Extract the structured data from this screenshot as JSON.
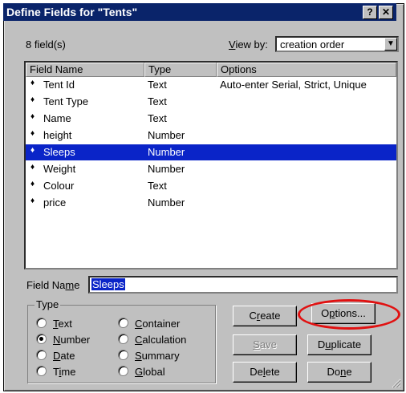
{
  "window": {
    "title": "Define Fields for \"Tents\"",
    "help_label": "?",
    "close_label": "✕"
  },
  "field_count": "8 field(s)",
  "view_by": {
    "label_prefix": "",
    "label_underlined": "V",
    "label_rest": "iew by:",
    "value": "creation order"
  },
  "table": {
    "headers": [
      "Field Name",
      "Type",
      "Options"
    ],
    "rows": [
      {
        "name": "Tent Id",
        "type": "Text",
        "options": "Auto-enter Serial, Strict, Unique",
        "selected": false
      },
      {
        "name": "Tent Type",
        "type": "Text",
        "options": "",
        "selected": false
      },
      {
        "name": "Name",
        "type": "Text",
        "options": "",
        "selected": false
      },
      {
        "name": "height",
        "type": "Number",
        "options": "",
        "selected": false
      },
      {
        "name": "Sleeps",
        "type": "Number",
        "options": "",
        "selected": true
      },
      {
        "name": "Weight",
        "type": "Number",
        "options": "",
        "selected": false
      },
      {
        "name": "Colour",
        "type": "Text",
        "options": "",
        "selected": false
      },
      {
        "name": "price",
        "type": "Number",
        "options": "",
        "selected": false
      }
    ]
  },
  "field_name": {
    "label_a": "Field Na",
    "label_u": "m",
    "label_b": "e",
    "value": "Sleeps"
  },
  "type_group": {
    "legend": "Type",
    "options": [
      {
        "u": "T",
        "rest": "ext",
        "checked": false
      },
      {
        "u": "N",
        "rest": "umber",
        "checked": true
      },
      {
        "u": "D",
        "rest": "ate",
        "checked": false
      },
      {
        "pre": "T",
        "u": "i",
        "rest": "me",
        "checked": false
      },
      {
        "u": "C",
        "rest": "ontainer",
        "checked": false
      },
      {
        "u": "C",
        "rest": "alculation",
        "checked": false
      },
      {
        "u": "S",
        "rest": "ummary",
        "checked": false
      },
      {
        "u": "G",
        "rest": "lobal",
        "checked": false
      }
    ]
  },
  "buttons": {
    "create": {
      "pre": "C",
      "u": "r",
      "post": "eate"
    },
    "options": {
      "pre": "O",
      "u": "p",
      "post": "tions..."
    },
    "save": {
      "pre": "",
      "u": "S",
      "post": "ave"
    },
    "duplicate": {
      "pre": "D",
      "u": "u",
      "post": "plicate"
    },
    "delete": {
      "pre": "De",
      "u": "l",
      "post": "ete"
    },
    "done": {
      "pre": "Do",
      "u": "n",
      "post": "e"
    }
  },
  "colors": {
    "titlebar": "#0a246a",
    "selection": "#0a24c8",
    "highlight_circle": "#e11010",
    "dialog_bg": "#c0c0c0"
  }
}
